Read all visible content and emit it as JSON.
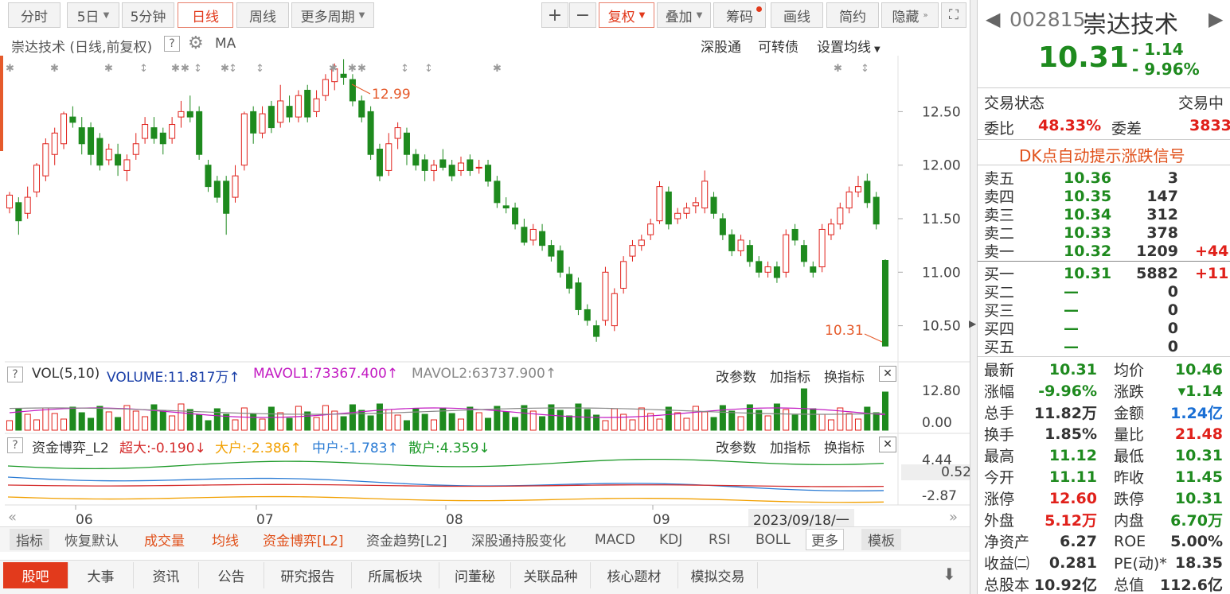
{
  "toolbar": {
    "items": [
      "分时",
      "5日",
      "5分钟",
      "日线",
      "周线",
      "更多周期"
    ],
    "active": "日线",
    "right": [
      "+",
      "−",
      "复权",
      "叠加",
      "筹码",
      "画线",
      "简约",
      "隐藏"
    ]
  },
  "chart_header": {
    "title": "崇达技术 (日线,前复权)",
    "help": "?",
    "ma": "MA",
    "links": [
      "深股通",
      "可转债",
      "设置均线"
    ]
  },
  "chart_data": {
    "type": "candlestick",
    "y_ticks": [
      "12.50",
      "12.00",
      "11.50",
      "11.00",
      "10.50"
    ],
    "ylim": [
      10.2,
      12.8
    ],
    "x_labels": [
      "06",
      "07",
      "08",
      "09"
    ],
    "annotations": {
      "high": "12.99",
      "last": "10.31"
    },
    "date_tip": "2023/09/18/一",
    "candles": [
      [
        11.6,
        11.72,
        11.75,
        11.55
      ],
      [
        11.65,
        11.48,
        11.7,
        11.35
      ],
      [
        11.55,
        11.7,
        11.8,
        11.5
      ],
      [
        11.75,
        12.0,
        12.02,
        11.7
      ],
      [
        11.9,
        12.2,
        12.25,
        11.85
      ],
      [
        12.1,
        12.3,
        12.35,
        12.0
      ],
      [
        12.2,
        12.48,
        12.5,
        12.15
      ],
      [
        12.45,
        12.4,
        12.55,
        12.35
      ],
      [
        12.35,
        12.2,
        12.45,
        12.1
      ],
      [
        12.35,
        12.1,
        12.4,
        12.0
      ],
      [
        12.25,
        12.0,
        12.3,
        11.95
      ],
      [
        12.05,
        12.15,
        12.2,
        12.0
      ],
      [
        12.1,
        12.0,
        12.2,
        11.9
      ],
      [
        11.95,
        12.05,
        12.1,
        11.85
      ],
      [
        12.1,
        12.2,
        12.3,
        12.05
      ],
      [
        12.25,
        12.38,
        12.45,
        12.2
      ],
      [
        12.35,
        12.25,
        12.45,
        12.2
      ],
      [
        12.3,
        12.2,
        12.35,
        12.1
      ],
      [
        12.25,
        12.38,
        12.45,
        12.2
      ],
      [
        12.45,
        12.5,
        12.6,
        12.35
      ],
      [
        12.5,
        12.45,
        12.65,
        12.4
      ],
      [
        12.5,
        12.1,
        12.55,
        12.05
      ],
      [
        12.0,
        11.8,
        12.05,
        11.75
      ],
      [
        11.85,
        11.7,
        11.9,
        11.65
      ],
      [
        11.85,
        11.55,
        11.9,
        11.35
      ],
      [
        11.7,
        11.9,
        12.0,
        11.65
      ],
      [
        12.0,
        12.48,
        12.5,
        11.95
      ],
      [
        12.5,
        12.3,
        12.55,
        12.2
      ],
      [
        12.3,
        12.48,
        12.55,
        12.25
      ],
      [
        12.55,
        12.35,
        12.6,
        12.3
      ],
      [
        12.4,
        12.6,
        12.75,
        12.35
      ],
      [
        12.55,
        12.45,
        12.65,
        12.4
      ],
      [
        12.45,
        12.65,
        12.7,
        12.4
      ],
      [
        12.7,
        12.45,
        12.75,
        12.4
      ],
      [
        12.5,
        12.62,
        12.7,
        12.45
      ],
      [
        12.65,
        12.8,
        12.85,
        12.6
      ],
      [
        12.78,
        12.9,
        12.95,
        12.7
      ],
      [
        12.85,
        12.82,
        12.99,
        12.75
      ],
      [
        12.8,
        12.6,
        12.85,
        12.55
      ],
      [
        12.6,
        12.45,
        12.65,
        12.4
      ],
      [
        12.5,
        12.1,
        12.55,
        12.05
      ],
      [
        12.15,
        11.9,
        12.2,
        11.85
      ],
      [
        11.95,
        12.2,
        12.3,
        11.9
      ],
      [
        12.25,
        12.35,
        12.4,
        12.15
      ],
      [
        12.3,
        12.1,
        12.35,
        12.0
      ],
      [
        12.1,
        12.0,
        12.15,
        11.95
      ],
      [
        12.05,
        11.95,
        12.1,
        11.85
      ],
      [
        11.95,
        12.0,
        12.05,
        11.85
      ],
      [
        12.05,
        11.98,
        12.15,
        11.95
      ],
      [
        12.0,
        11.9,
        12.05,
        11.85
      ],
      [
        11.95,
        12.02,
        12.08,
        11.9
      ],
      [
        12.05,
        11.95,
        12.1,
        11.9
      ],
      [
        11.98,
        11.98,
        12.05,
        11.92
      ],
      [
        12.0,
        11.85,
        12.05,
        11.8
      ],
      [
        11.85,
        11.65,
        11.9,
        11.6
      ],
      [
        11.62,
        11.6,
        11.7,
        11.55
      ],
      [
        11.6,
        11.45,
        11.65,
        11.4
      ],
      [
        11.42,
        11.28,
        11.5,
        11.25
      ],
      [
        11.3,
        11.4,
        11.45,
        11.25
      ],
      [
        11.38,
        11.25,
        11.45,
        11.2
      ],
      [
        11.25,
        11.15,
        11.3,
        11.1
      ],
      [
        11.2,
        11.0,
        11.25,
        10.95
      ],
      [
        10.98,
        10.85,
        11.05,
        10.8
      ],
      [
        10.9,
        10.65,
        10.95,
        10.6
      ],
      [
        10.65,
        10.55,
        10.7,
        10.5
      ],
      [
        10.5,
        10.4,
        10.55,
        10.35
      ],
      [
        10.55,
        11.0,
        11.05,
        10.5
      ],
      [
        10.5,
        10.8,
        10.85,
        10.45
      ],
      [
        10.85,
        11.1,
        11.15,
        10.8
      ],
      [
        11.15,
        11.25,
        11.3,
        11.1
      ],
      [
        11.25,
        11.3,
        11.35,
        11.2
      ],
      [
        11.35,
        11.45,
        11.5,
        11.3
      ],
      [
        11.48,
        11.8,
        11.85,
        11.45
      ],
      [
        11.75,
        11.45,
        11.8,
        11.4
      ],
      [
        11.5,
        11.55,
        11.6,
        11.45
      ],
      [
        11.55,
        11.6,
        11.65,
        11.5
      ],
      [
        11.62,
        11.65,
        11.7,
        11.55
      ],
      [
        11.6,
        11.85,
        11.95,
        11.55
      ],
      [
        11.7,
        11.55,
        11.75,
        11.5
      ],
      [
        11.5,
        11.35,
        11.55,
        11.3
      ],
      [
        11.35,
        11.2,
        11.4,
        11.15
      ],
      [
        11.2,
        11.3,
        11.35,
        11.15
      ],
      [
        11.25,
        11.1,
        11.3,
        11.05
      ],
      [
        11.1,
        11.0,
        11.15,
        10.95
      ],
      [
        11.0,
        11.05,
        11.1,
        10.95
      ],
      [
        11.05,
        10.95,
        11.1,
        10.9
      ],
      [
        11.0,
        11.35,
        11.4,
        10.95
      ],
      [
        11.4,
        11.3,
        11.45,
        11.25
      ],
      [
        11.25,
        11.1,
        11.3,
        11.05
      ],
      [
        11.05,
        11.0,
        11.1,
        10.95
      ],
      [
        11.05,
        11.4,
        11.45,
        11.0
      ],
      [
        11.35,
        11.45,
        11.5,
        11.3
      ],
      [
        11.45,
        11.6,
        11.65,
        11.4
      ],
      [
        11.6,
        11.75,
        11.8,
        11.55
      ],
      [
        11.75,
        11.8,
        11.9,
        11.7
      ],
      [
        11.85,
        11.65,
        11.92,
        11.6
      ],
      [
        11.7,
        11.45,
        11.75,
        11.4
      ],
      [
        11.11,
        10.31,
        11.12,
        10.31
      ]
    ]
  },
  "volume": {
    "label": "VOL(5,10)",
    "volume": "VOLUME:11.817万",
    "mavol1": "MAVOL1:73367.400",
    "mavol2": "MAVOL2:63737.900",
    "ticks": [
      "12.80",
      "0.00"
    ],
    "links": [
      "改参数",
      "加指标",
      "换指标"
    ]
  },
  "fund": {
    "label": "资金博弈_L2",
    "super": "超大:-0.190",
    "big": "大户:-2.386",
    "mid": "中户:-1.783",
    "retail": "散户:4.359",
    "ticks": [
      "4.44",
      "0.52",
      "-2.87"
    ],
    "links": [
      "改参数",
      "加指标",
      "换指标"
    ],
    "colors": {
      "super": "#d42a2a",
      "big": "#f2a000",
      "mid": "#2a7bd4",
      "retail": "#1e9a2a"
    }
  },
  "indicator_tabs": [
    "指标",
    "恢复默认",
    "成交量",
    "均线",
    "资金博弈[L2]",
    "资金趋势[L2]",
    "深股通持股变化",
    "MACD",
    "KDJ",
    "RSI",
    "BOLL",
    "更多",
    "模板"
  ],
  "bottom_tabs": [
    "股吧",
    "大事",
    "资讯",
    "公告",
    "研究报告",
    "所属板块",
    "问董秘",
    "关联品种",
    "核心题材",
    "模拟交易"
  ],
  "quote": {
    "code": "002815",
    "name": "崇达技术",
    "price": "10.31",
    "change": "- 1.14",
    "pct": "- 9.96%",
    "status_label": "交易状态",
    "status": "交易中",
    "wb_label": "委比",
    "wb": "48.33%",
    "wc_label": "委差",
    "wc": "3833",
    "dk": "DK点自动提示涨跌信号",
    "asks": [
      {
        "l": "卖五",
        "p": "10.36",
        "v": "3",
        "d": ""
      },
      {
        "l": "卖四",
        "p": "10.35",
        "v": "147",
        "d": ""
      },
      {
        "l": "卖三",
        "p": "10.34",
        "v": "312",
        "d": ""
      },
      {
        "l": "卖二",
        "p": "10.33",
        "v": "378",
        "d": ""
      },
      {
        "l": "卖一",
        "p": "10.32",
        "v": "1209",
        "d": "+44"
      }
    ],
    "bids": [
      {
        "l": "买一",
        "p": "10.31",
        "v": "5882",
        "d": "+11"
      },
      {
        "l": "买二",
        "p": "—",
        "v": "0",
        "d": ""
      },
      {
        "l": "买三",
        "p": "—",
        "v": "0",
        "d": ""
      },
      {
        "l": "买四",
        "p": "—",
        "v": "0",
        "d": ""
      },
      {
        "l": "买五",
        "p": "—",
        "v": "0",
        "d": ""
      }
    ],
    "stats": [
      {
        "l1": "最新",
        "v1": "10.31",
        "l2": "均价",
        "v2": "10.46"
      },
      {
        "l1": "涨幅",
        "v1": "-9.96%",
        "l2": "涨跌",
        "v2": "▾1.14"
      },
      {
        "l1": "总手",
        "v1": "11.82万",
        "l2": "金额",
        "v2": "1.24亿"
      },
      {
        "l1": "换手",
        "v1": "1.85%",
        "l2": "量比",
        "v2": "21.48"
      },
      {
        "l1": "最高",
        "v1": "11.12",
        "l2": "最低",
        "v2": "10.31"
      },
      {
        "l1": "今开",
        "v1": "11.11",
        "l2": "昨收",
        "v2": "11.45"
      },
      {
        "l1": "涨停",
        "v1": "12.60",
        "l2": "跌停",
        "v2": "10.31"
      },
      {
        "l1": "外盘",
        "v1": "5.12万",
        "l2": "内盘",
        "v2": "6.70万"
      },
      {
        "l1": "净资产",
        "v1": "6.27",
        "l2": "ROE",
        "v2": "5.00%"
      },
      {
        "l1": "收益㈡",
        "v1": "0.281",
        "l2": "PE(动)*",
        "v2": "18.35"
      },
      {
        "l1": "总股本",
        "v1": "10.92亿",
        "l2": "总值",
        "v2": "112.6亿"
      }
    ]
  }
}
